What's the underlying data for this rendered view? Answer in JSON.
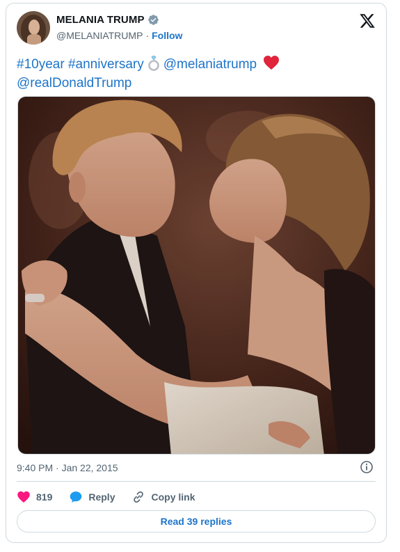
{
  "author": {
    "name": "MELANIA TRUMP",
    "handle": "@MELANIATRUMP",
    "separator": "·",
    "follow_label": "Follow"
  },
  "tweet": {
    "hashtag1": "#10year",
    "hashtag2": "#anniversary",
    "mention1": "@melaniatrump",
    "mention2": "@realDonaldTrump",
    "emoji_ring": "ring-icon",
    "emoji_heart": "red-heart-icon"
  },
  "timestamp": "9:40 PM · Jan 22, 2015",
  "actions": {
    "like_count": "819",
    "reply_label": "Reply",
    "copy_label": "Copy link"
  },
  "read_replies_label": "Read 39 replies",
  "colors": {
    "link_blue": "#1d74c9",
    "heart_pink": "#f91880",
    "text_gray": "#536471",
    "border": "#cfd9de"
  }
}
